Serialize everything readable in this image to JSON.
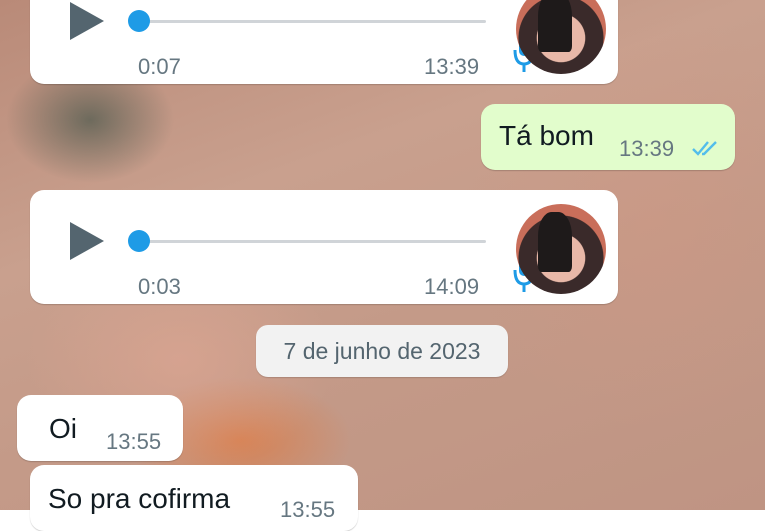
{
  "voice_messages": [
    {
      "duration": "0:07",
      "time": "13:39",
      "progress": 0.0
    },
    {
      "duration": "0:03",
      "time": "14:09",
      "progress": 0.0
    }
  ],
  "outgoing": {
    "text": "Tá bom",
    "time": "13:39",
    "status": "read"
  },
  "date_divider": "7 de junho de 2023",
  "incoming": [
    {
      "text": "Oi",
      "time": "13:55"
    },
    {
      "text": "So pra cofirma",
      "time": "13:55"
    }
  ],
  "colors": {
    "outgoing_bubble": "#e2fdcc",
    "incoming_bubble": "#ffffff",
    "accent": "#1e9be6",
    "read_ticks": "#53bdeb"
  },
  "icons": {
    "play": "play-icon",
    "mic": "microphone-icon",
    "ticks": "double-check-icon"
  }
}
